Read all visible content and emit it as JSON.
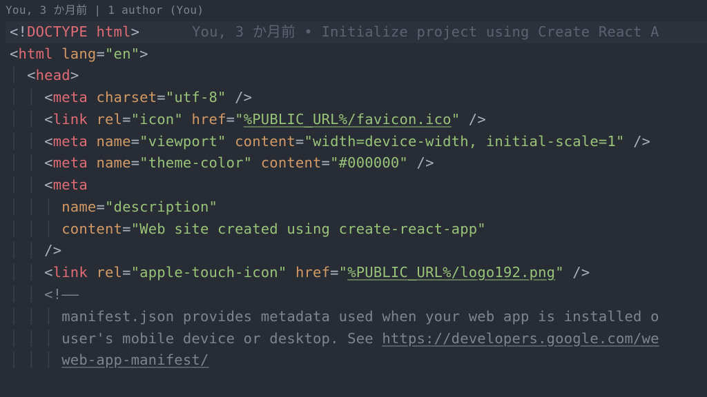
{
  "blame": {
    "summary": "You, 3 か月前 | 1 author (You)",
    "inline": "You, 3 か月前 • Initialize project using Create React A"
  },
  "lines": {
    "l1": {
      "p1": "<!",
      "doctype": "DOCTYPE",
      "sp": " ",
      "html": "html",
      "p2": ">"
    },
    "l2": {
      "p1": "<",
      "tag": "html",
      "sp": " ",
      "attr": "lang",
      "eq": "=",
      "val": "\"en\"",
      "p2": ">"
    },
    "l3": {
      "p1": "<",
      "tag": "head",
      "p2": ">"
    },
    "l4": {
      "p1": "<",
      "tag": "meta",
      "sp": " ",
      "attr": "charset",
      "eq": "=",
      "val": "\"utf-8\"",
      "close": " />"
    },
    "l5": {
      "p1": "<",
      "tag": "link",
      "sp": " ",
      "a1": "rel",
      "eq1": "=",
      "v1": "\"icon\"",
      "sp2": " ",
      "a2": "href",
      "eq2": "=",
      "q2a": "\"",
      "url": "%PUBLIC_URL%/favicon.ico",
      "q2b": "\"",
      "close": " />"
    },
    "l6": {
      "p1": "<",
      "tag": "meta",
      "sp": " ",
      "a1": "name",
      "eq1": "=",
      "v1": "\"viewport\"",
      "sp2": " ",
      "a2": "content",
      "eq2": "=",
      "v2": "\"width=device-width, initial-scale=1\"",
      "close": " />"
    },
    "l7": {
      "p1": "<",
      "tag": "meta",
      "sp": " ",
      "a1": "name",
      "eq1": "=",
      "v1": "\"theme-color\"",
      "sp2": " ",
      "a2": "content",
      "eq2": "=",
      "v2": "\"#000000\"",
      "close": " />"
    },
    "l8": {
      "p1": "<",
      "tag": "meta"
    },
    "l9": {
      "attr": "name",
      "eq": "=",
      "val": "\"description\""
    },
    "l10": {
      "attr": "content",
      "eq": "=",
      "val": "\"Web site created using create-react-app\""
    },
    "l11": {
      "close": "/>"
    },
    "l12": {
      "p1": "<",
      "tag": "link",
      "sp": " ",
      "a1": "rel",
      "eq1": "=",
      "v1": "\"apple-touch-icon\"",
      "sp2": " ",
      "a2": "href",
      "eq2": "=",
      "q2a": "\"",
      "url": "%PUBLIC_URL%/logo192.png",
      "q2b": "\"",
      "close": " />"
    },
    "l13": {
      "open": "<!——"
    },
    "l14": {
      "text": "manifest.json provides metadata used when your web app is installed o"
    },
    "l15": {
      "text": "user's mobile device or desktop. See ",
      "url": "https://developers.google.com/we"
    },
    "l16": {
      "url": "web-app-manifest/"
    }
  }
}
